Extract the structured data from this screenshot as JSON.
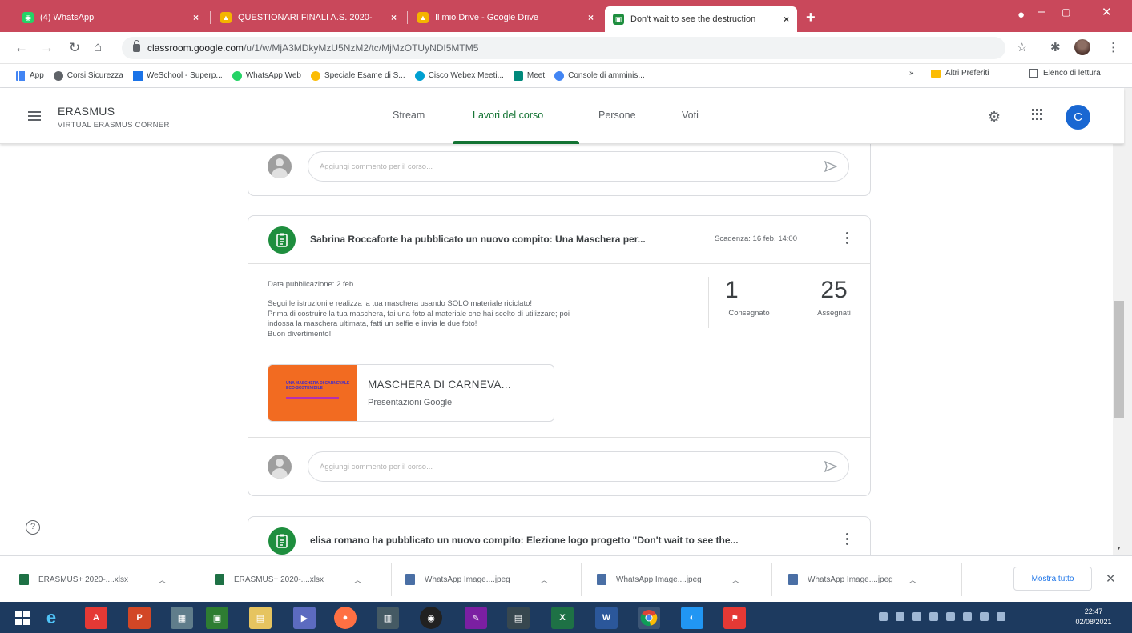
{
  "browser": {
    "tabs": [
      {
        "title": "(4) WhatsApp",
        "icon": "whatsapp-icon",
        "color": "#25d366"
      },
      {
        "title": "QUESTIONARI FINALI A.S. 2020-",
        "icon": "google-drive-icon",
        "color": "#f4b400"
      },
      {
        "title": "Il mio Drive - Google Drive",
        "icon": "google-drive-icon",
        "color": "#f4b400"
      },
      {
        "title": "Don't wait to see the destruction",
        "icon": "classroom-icon",
        "color": "#1e8e3e"
      }
    ],
    "url_host": "classroom.google.com",
    "url_path": "/u/1/w/MjA3MDkyMzU5NzM2/tc/MjMzOTUyNDI5MTM5",
    "bookmarks": [
      "App",
      "Corsi Sicurezza",
      "WeSchool - Superp...",
      "WhatsApp Web",
      "Speciale Esame di S...",
      "Cisco Webex Meeti...",
      "Meet",
      "Console di amminis..."
    ],
    "bookmarks_right": [
      "Altri Preferiti",
      "Elenco di lettura"
    ],
    "bookmarks_more": "»"
  },
  "classroom": {
    "class_name": "ERASMUS",
    "class_section": "VIRTUAL ERASMUS CORNER",
    "nav": [
      "Stream",
      "Lavori del corso",
      "Persone",
      "Voti"
    ],
    "avatar_letter": "C",
    "comment_placeholder": "Aggiungi commento per il corso...",
    "post": {
      "title": "Sabrina Roccaforte ha pubblicato un nuovo compito: Una Maschera per...",
      "due": "Scadenza: 16 feb, 14:00",
      "published": "Data pubblicazione: 2 feb",
      "description": [
        "Segui le istruzioni e realizza la tua maschera usando SOLO materiale riciclato!",
        "Prima di costruire la tua maschera, fai una foto al materiale che hai scelto di utilizzare; poi",
        "indossa la maschera ultimata, fatti un selfie e invia le due foto!",
        "Buon divertimento!"
      ],
      "turned_in": "1",
      "turned_in_label": "Consegnato",
      "assigned": "25",
      "assigned_label": "Assegnati",
      "attachment_title": "MASCHERA DI CARNEVA...",
      "attachment_type": "Presentazioni Google",
      "thumb_text": "UNA MASCHERA DI CARNEVALE ECO-SOSTENIBILE"
    },
    "post2_title": "elisa romano ha pubblicato un nuovo compito: Elezione logo progetto \"Don't wait to see the..."
  },
  "downloads": {
    "items": [
      {
        "name": "ERASMUS+ 2020-....xlsx",
        "color": "#1e7145"
      },
      {
        "name": "ERASMUS+ 2020-....xlsx",
        "color": "#1e7145"
      },
      {
        "name": "WhatsApp Image....jpeg",
        "color": "#4a6fa5"
      },
      {
        "name": "WhatsApp Image....jpeg",
        "color": "#4a6fa5"
      },
      {
        "name": "WhatsApp Image....jpeg",
        "color": "#4a6fa5"
      }
    ],
    "show_all": "Mostra tutto"
  },
  "taskbar": {
    "time": "22:47",
    "date": "02/08/2021"
  }
}
